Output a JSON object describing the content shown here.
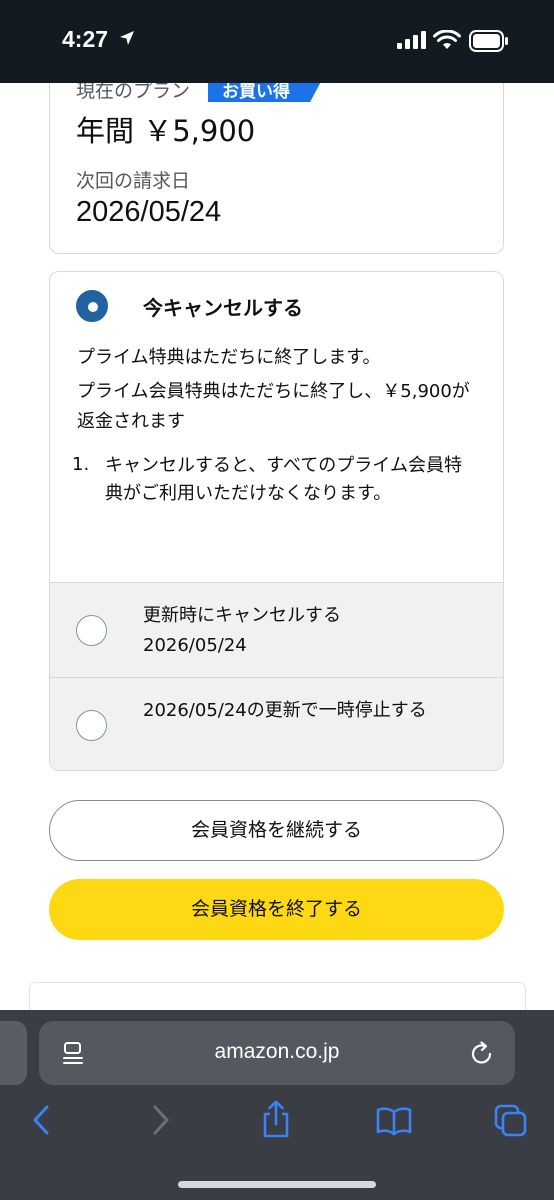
{
  "status_bar": {
    "time": "4:27"
  },
  "plan": {
    "current_plan_label": "現在のプラン",
    "badge": "お買い得",
    "price": "年間 ￥5,900",
    "next_billing_label": "次回の請求日",
    "next_billing_date": "2026/05/24"
  },
  "options": {
    "selected": {
      "title": "今キャンセルする",
      "desc1": "プライム特典はただちに終了します。",
      "desc2": "プライム会員特典はただちに終了し、￥5,900が返金されます",
      "list_number": "1.",
      "list_text": "キャンセルすると、すべてのプライム会員特典がご利用いただけなくなります。"
    },
    "cancel_at_renewal": {
      "line1": "更新時にキャンセルする",
      "line2": "2026/05/24"
    },
    "pause_at_renewal": {
      "text": "2026/05/24の更新で一時停止する"
    }
  },
  "buttons": {
    "continue_label": "会員資格を継続する",
    "end_label": "会員資格を終了する"
  },
  "browser": {
    "url": "amazon.co.jp"
  },
  "colors": {
    "accent_blue": "#2162a1",
    "badge_blue": "#1a73e8",
    "end_button_yellow": "#ffd814",
    "ios_blue": "#3b82f6"
  }
}
